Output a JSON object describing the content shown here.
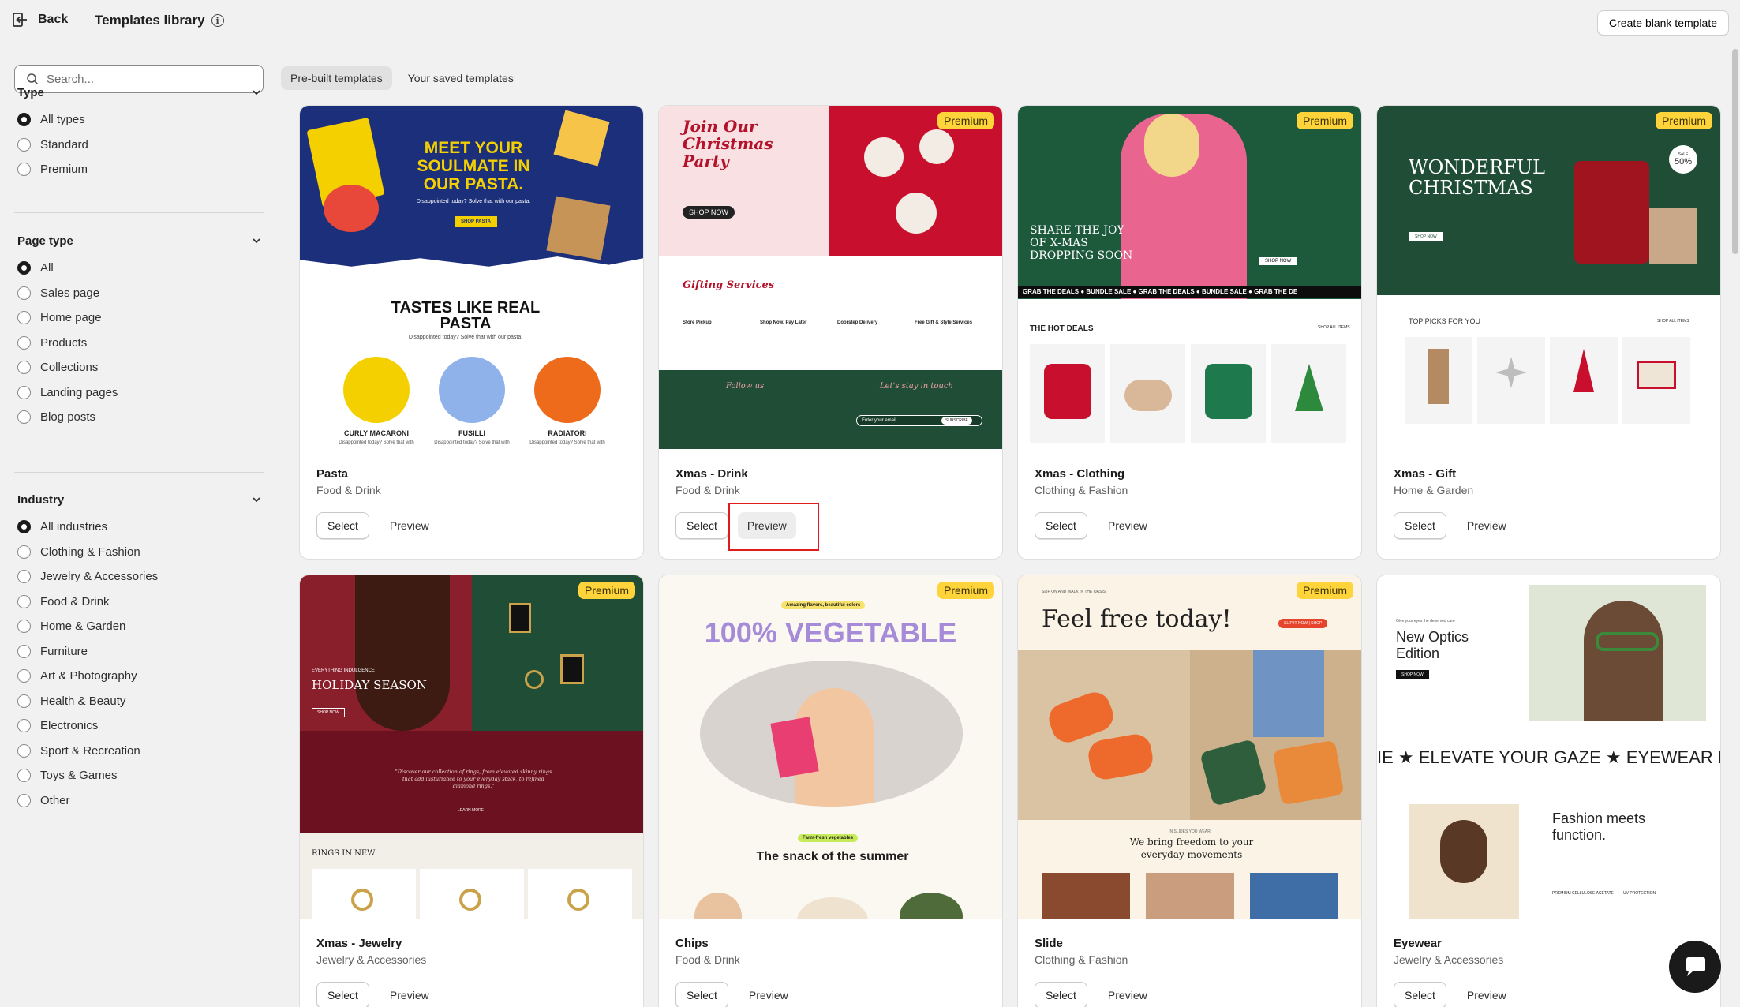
{
  "topbar": {
    "back_label": "Back",
    "title": "Templates library",
    "create_label": "Create blank template"
  },
  "search": {
    "placeholder": "Search..."
  },
  "filters": {
    "type": {
      "title": "Type",
      "options": [
        "All types",
        "Standard",
        "Premium"
      ],
      "selected": 0
    },
    "page_type": {
      "title": "Page type",
      "options": [
        "All",
        "Sales page",
        "Home page",
        "Products",
        "Collections",
        "Landing pages",
        "Blog posts"
      ],
      "selected": 0
    },
    "industry": {
      "title": "Industry",
      "options": [
        "All industries",
        "Clothing & Fashion",
        "Jewelry & Accessories",
        "Food & Drink",
        "Home & Garden",
        "Furniture",
        "Art & Photography",
        "Health & Beauty",
        "Electronics",
        "Sport & Recreation",
        "Toys & Games",
        "Other"
      ],
      "selected": 0
    }
  },
  "tabs": [
    {
      "label": "Pre-built templates",
      "active": true
    },
    {
      "label": "Your saved templates",
      "active": false
    }
  ],
  "card_actions": {
    "select": "Select",
    "preview": "Preview",
    "premium": "Premium"
  },
  "cards": [
    {
      "name": "Pasta",
      "category": "Food & Drink",
      "premium": false,
      "thumb": {
        "headline": "MEET YOUR SOULMATE IN OUR PASTA.",
        "sub": "Disappointed today? Solve that with our pasta.",
        "cta": "SHOP PASTA",
        "section": "TASTES LIKE REAL PASTA",
        "section_sub": "Disappointed today? Solve that with our pasta.",
        "items": [
          "CURLY MACARONI",
          "FUSILLI",
          "RADIATORI"
        ],
        "item_sub": "Disappointed today? Solve that with"
      }
    },
    {
      "name": "Xmas - Drink",
      "category": "Food & Drink",
      "premium": true,
      "thumb": {
        "headline": "Join Our Christmas Party",
        "cta": "SHOP NOW",
        "section": "Gifting Services",
        "services": [
          "Store Pickup",
          "Shop Now, Pay Later",
          "Doorstep Delivery",
          "Free Gift & Style Services"
        ],
        "follow": "Follow us",
        "stay": "Let's stay in touch",
        "email": "Enter your email",
        "subscribe": "SUBSCRIBE"
      }
    },
    {
      "name": "Xmas - Clothing",
      "category": "Clothing & Fashion",
      "premium": true,
      "thumb": {
        "headline": "SHARE THE JOY OF X-MAS DROPPING SOON",
        "cta": "SHOP NOW",
        "ticker": "GRAB THE DEALS  ●  BUNDLE SALE  ●  GRAB THE DEALS  ●  BUNDLE SALE  ●  GRAB THE DE",
        "section": "THE HOT DEALS",
        "shop_all": "SHOP ALL ITEMS"
      }
    },
    {
      "name": "Xmas - Gift",
      "category": "Home & Garden",
      "premium": true,
      "thumb": {
        "headline": "WONDERFUL CHRISTMAS",
        "cta": "SHOP NOW",
        "badge": "50%",
        "badge_label": "SALE",
        "section": "TOP PICKS FOR YOU",
        "shop_all": "SHOP ALL ITEMS"
      }
    },
    {
      "name": "Xmas - Jewelry",
      "category": "Jewelry & Accessories",
      "premium": true,
      "thumb": {
        "kicker": "EVERYTHING INDULGENCE",
        "headline": "HOLIDAY SEASON",
        "cta": "SHOP NOW",
        "quote": "\"Discover our collection of rings, from elevated skinny rings that add lusturiance to your everyday stack, to refined diamond rings.\"",
        "learn": "LEARN MORE",
        "section": "RINGS IN NEW"
      }
    },
    {
      "name": "Chips",
      "category": "Food & Drink",
      "premium": true,
      "thumb": {
        "tag": "Amazing flavors, beautiful colors",
        "headline": "100% VEGETABLE",
        "tag2": "Farm-fresh vegetables",
        "section": "The snack of the summer"
      }
    },
    {
      "name": "Slide",
      "category": "Clothing & Fashion",
      "premium": true,
      "thumb": {
        "kicker": "SLIP ON AND WALK IN THE OASIS",
        "headline": "Feel free today!",
        "cta": "SLIP IT NOW | SHOP",
        "kicker2": "IN SLIDES YOU WEAR",
        "section": "We bring freedom to your everyday movements"
      }
    },
    {
      "name": "Eyewear",
      "category": "Jewelry & Accessories",
      "premium": false,
      "thumb": {
        "kicker": "Give your eyes the deserved care",
        "headline": "New Optics Edition",
        "cta": "SHOP NOW",
        "marquee": "IE  ★  ELEVATE YOUR GAZE  ★  EYEWEAR I",
        "section": "Fashion meets function.",
        "features": [
          "PREMIUM CELLULOSE ACETATE",
          "UV PROTECTION"
        ]
      }
    }
  ],
  "colors": {
    "pasta_blue": "#1c2f7a",
    "pasta_yellow": "#f5d000",
    "xmas_red": "#c8102e",
    "xmas_green": "#1f4d36",
    "highlight_red": "#e01b1b",
    "premium_badge": "#ffd43b"
  }
}
